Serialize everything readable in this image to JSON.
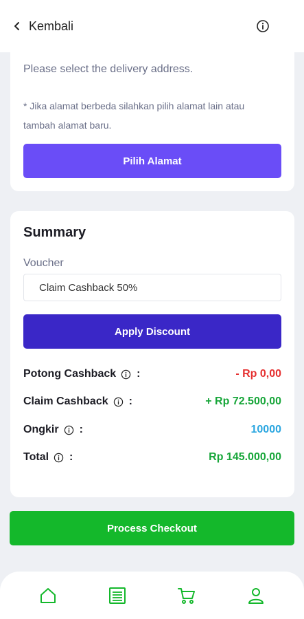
{
  "header": {
    "back_label": "Kembali",
    "back_icon": "chevron-left-icon",
    "info_icon": "info-icon"
  },
  "address": {
    "description": "Please select the delivery address.",
    "note": "* Jika alamat berbeda silahkan pilih alamat lain atau tambah alamat baru.",
    "button_label": "Pilih Alamat"
  },
  "summary": {
    "title": "Summary",
    "voucher_label": "Voucher",
    "voucher_value": "Claim Cashback 50%",
    "apply_label": "Apply Discount",
    "rows": [
      {
        "label": "Potong Cashback",
        "value": "- Rp 0,00",
        "color": "#e53030"
      },
      {
        "label": "Claim Cashback",
        "value": "+ Rp 72.500,00",
        "color": "#18a63a"
      },
      {
        "label": "Ongkir",
        "value": "10000",
        "color": "#2aa6e0"
      },
      {
        "label": "Total",
        "value": "Rp 145.000,00",
        "color": "#18a63a"
      }
    ]
  },
  "checkout": {
    "label": "Process Checkout"
  },
  "bottom_nav": {
    "items": [
      {
        "icon": "home-icon"
      },
      {
        "icon": "document-icon"
      },
      {
        "icon": "cart-icon"
      },
      {
        "icon": "user-icon"
      }
    ],
    "accent": "#14b82b"
  },
  "colors": {
    "primary_purple": "#6a4df7",
    "dark_purple": "#3a27c7",
    "green": "#14b82b",
    "background": "#eef0f4"
  }
}
